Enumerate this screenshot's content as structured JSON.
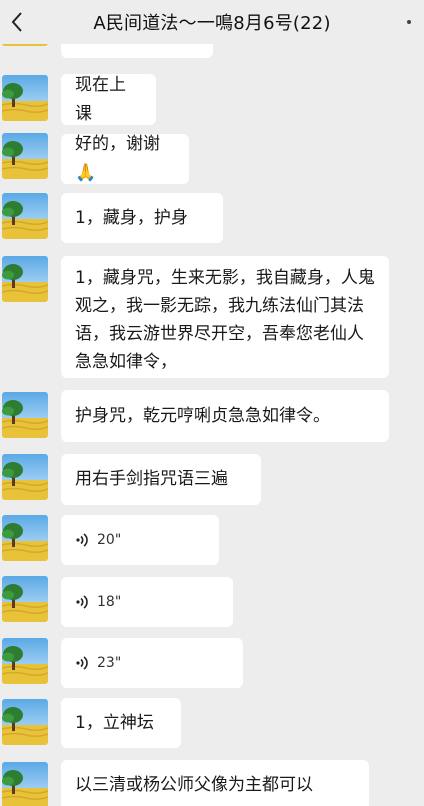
{
  "header": {
    "title": "A民间道法～一鳴8月6号(22)",
    "back_icon": "chevron-left-icon",
    "more_icon": "more-vertical-icon"
  },
  "messages": [
    {
      "type": "text",
      "text": "现在上课"
    },
    {
      "type": "text",
      "text": "好的，谢谢🙏"
    },
    {
      "type": "text",
      "text": "1，藏身，护身"
    },
    {
      "type": "text",
      "text": "1，藏身咒，生来无影，我自藏身，人鬼观之，我一影无踪，我九练法仙门其法语，我云游世界尽开空，吾奉您老仙人急急如律令，"
    },
    {
      "type": "text",
      "text": "护身咒，乾元哼唎贞急急如律令。"
    },
    {
      "type": "text",
      "text": "用右手剑指咒语三遍"
    },
    {
      "type": "voice",
      "duration": "20\""
    },
    {
      "type": "voice",
      "duration": "18\""
    },
    {
      "type": "voice",
      "duration": "23\""
    },
    {
      "type": "text",
      "text": "1，立神坛"
    },
    {
      "type": "text",
      "text": "以三清或杨公师父像为主都可以"
    }
  ],
  "colors": {
    "background": "#ededed",
    "bubble": "#ffffff",
    "avatar_sky": "#5aa9e6",
    "avatar_field": "#e8c33a",
    "avatar_tree": "#2e7d32"
  }
}
